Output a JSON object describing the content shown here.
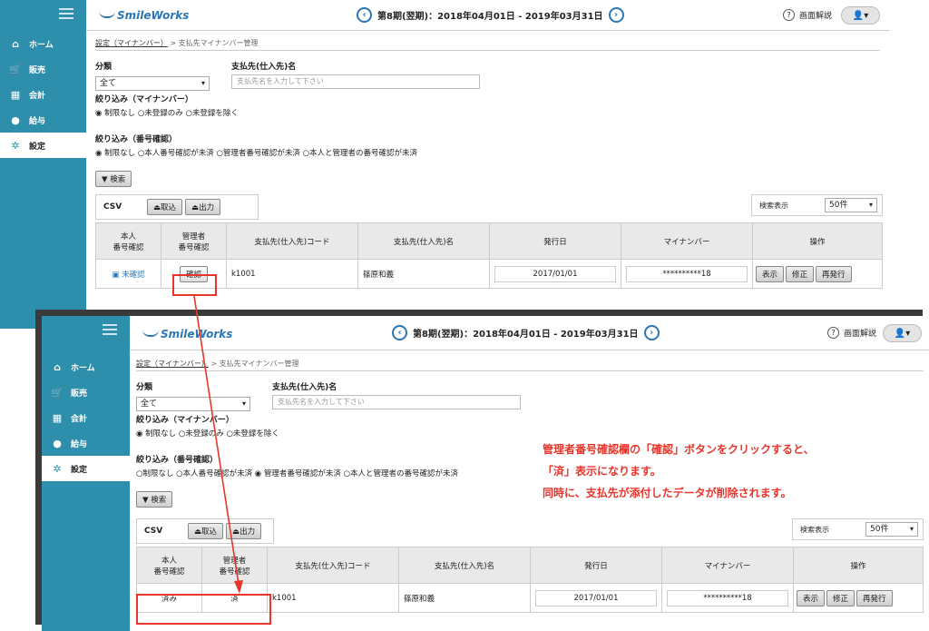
{
  "app": {
    "logo": "SmileWorks",
    "period": "第8期(翌期)：2018年04月01日 - 2019年03月31日",
    "help": "画面解説",
    "user_icon": "user-icon",
    "prev_icon": "chevron-left-icon",
    "next_icon": "chevron-right-icon"
  },
  "sidebar": {
    "items": [
      {
        "label": "ホーム",
        "icon": "home-icon"
      },
      {
        "label": "販売",
        "icon": "cart-icon"
      },
      {
        "label": "会計",
        "icon": "calculator-icon"
      },
      {
        "label": "給与",
        "icon": "money-bag-icon"
      },
      {
        "label": "設定",
        "icon": "gear-icon"
      }
    ]
  },
  "breadcrumb": {
    "parent": "設定（マイナンバー）",
    "sep": ">",
    "current": "支払先マイナンバー管理"
  },
  "form": {
    "category_label": "分類",
    "category_value": "全て",
    "payee_label": "支払先(仕入先)名",
    "payee_placeholder": "支払先名を入力して下さい",
    "filter_mynumber_label": "絞り込み（マイナンバー）",
    "filter_mynumber_options": [
      "制限なし",
      "未登録のみ",
      "未登録を除く"
    ],
    "filter_confirm_label": "絞り込み（番号確認）",
    "filter_confirm_options": [
      "制限なし",
      "本人番号確認が未済",
      "管理者番号確認が未済",
      "本人と管理者の番号確認が未済"
    ],
    "search_button": "検索"
  },
  "csv": {
    "label": "CSV",
    "import": "取込",
    "export": "出力",
    "display_label": "検索表示",
    "display_value": "50件"
  },
  "table": {
    "headers": [
      "本人\n番号確認",
      "管理者\n番号確認",
      "支払先(仕入先)コード",
      "支払先(仕入先)名",
      "発行日",
      "マイナンバー",
      "操作"
    ],
    "before": {
      "self_confirm": "未確認",
      "admin_confirm": "確認",
      "code": "k1001",
      "name": "篠原和義",
      "issue_date": "2017/01/01",
      "mynumber": "**********18"
    },
    "after": {
      "self_confirm": "済み",
      "admin_confirm": "済",
      "code": "k1001",
      "name": "篠原和義",
      "issue_date": "2017/01/01",
      "mynumber": "**********18"
    },
    "actions": [
      "表示",
      "修正",
      "再発行"
    ]
  },
  "annotation": {
    "line1": "管理者番号確認欄の「確認」ボタンをクリックすると、",
    "line2": "「済」表示になります。",
    "line3": "同時に、支払先が添付したデータが削除されます。",
    "color": "#e8352b"
  }
}
